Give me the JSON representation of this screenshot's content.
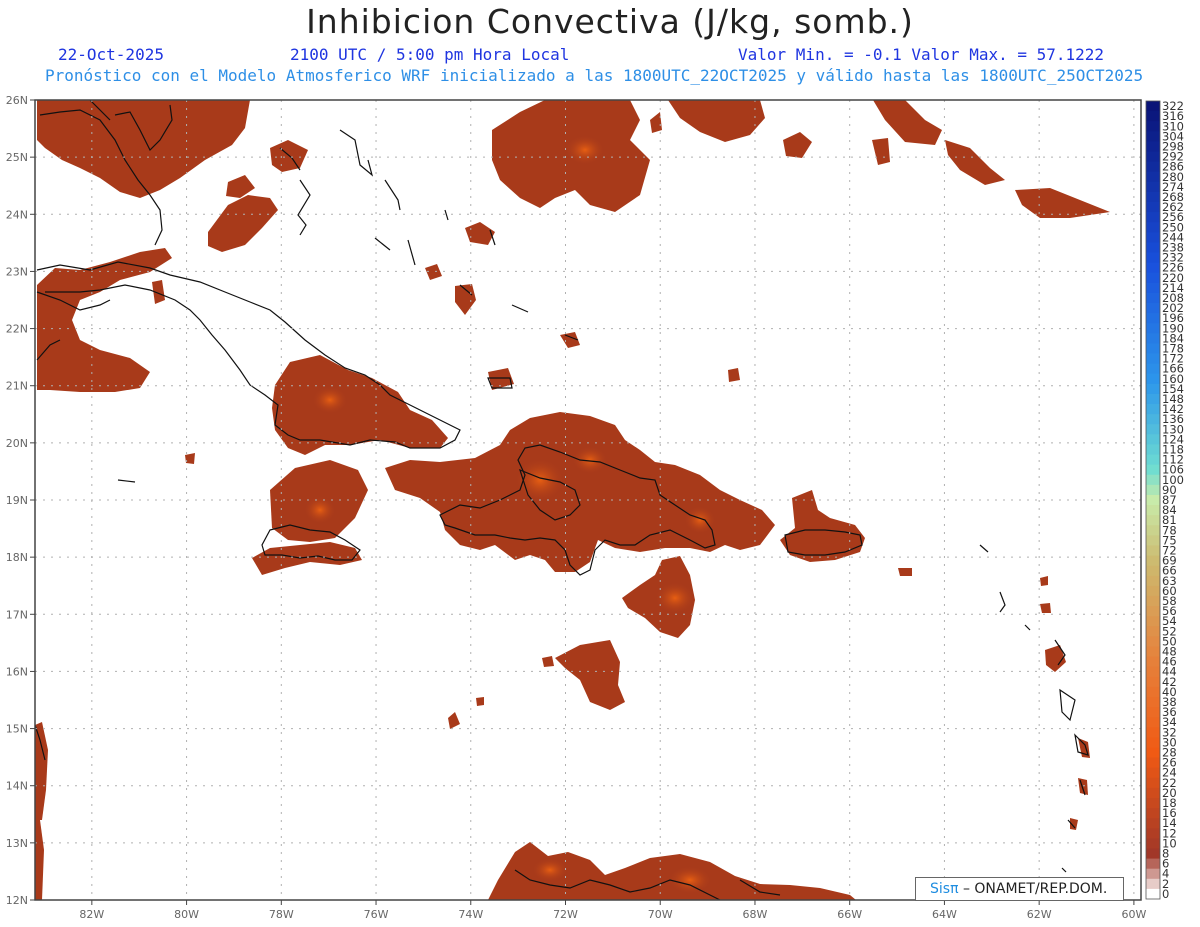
{
  "header": {
    "title": "Inhibicion Convectiva (J/kg, somb.)",
    "date": "22-Oct-2025",
    "time": "2100 UTC / 5:00 pm Hora Local",
    "value_range": "Valor Min. = -0.1  Valor Max. = 57.1222",
    "model_info": "Pronóstico con el Modelo Atmosferico WRF inicializado a las 1800UTC_22OCT2025 y válido hasta las  1800UTC_25OCT2025"
  },
  "map": {
    "lat_labels": [
      "26N",
      "25N",
      "24N",
      "23N",
      "22N",
      "21N",
      "20N",
      "19N",
      "18N",
      "17N",
      "16N",
      "15N",
      "14N",
      "13N",
      "12N"
    ],
    "lon_labels": [
      "82W",
      "80W",
      "78W",
      "76W",
      "74W",
      "72W",
      "70W",
      "68W",
      "66W",
      "64W",
      "62W",
      "60W"
    ],
    "lat_range": [
      12,
      26
    ],
    "lon_range": [
      -83.2,
      -59.85
    ],
    "grid": true,
    "field_color": "#a83a1a",
    "field_highlight": "#e05a14"
  },
  "colorbar": {
    "labels": [
      "322",
      "316",
      "310",
      "304",
      "298",
      "292",
      "286",
      "280",
      "274",
      "268",
      "262",
      "256",
      "250",
      "244",
      "238",
      "232",
      "226",
      "220",
      "214",
      "208",
      "202",
      "196",
      "190",
      "184",
      "178",
      "172",
      "166",
      "160",
      "154",
      "148",
      "142",
      "136",
      "130",
      "124",
      "118",
      "112",
      "106",
      "100",
      "90",
      "87",
      "84",
      "81",
      "78",
      "75",
      "72",
      "69",
      "66",
      "63",
      "60",
      "58",
      "56",
      "54",
      "52",
      "50",
      "48",
      "46",
      "44",
      "42",
      "40",
      "38",
      "36",
      "34",
      "32",
      "30",
      "28",
      "26",
      "24",
      "22",
      "20",
      "18",
      "16",
      "14",
      "12",
      "10",
      "8",
      "6",
      "4",
      "2",
      "0"
    ]
  },
  "credit": {
    "logo": "Sisπ",
    "text": "– ONAMET/REP.DOM."
  }
}
